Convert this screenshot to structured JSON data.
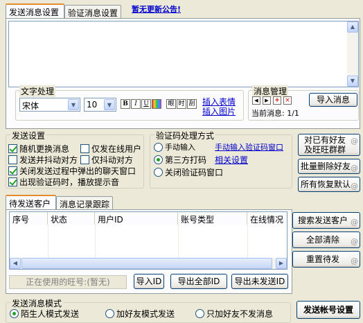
{
  "tabs": {
    "send_settings": "发送消息设置",
    "verify_settings": "验证消息设置",
    "announcement": "暂无更新公告!"
  },
  "text_processing": {
    "title": "文字处理",
    "font": "宋体",
    "size": "10",
    "bold": "B",
    "italic": "I",
    "underline": "U",
    "fx1": "眼",
    "fx2": "时",
    "fx3": "刮",
    "insert_emoji": "插入表情",
    "insert_image": "插入图片"
  },
  "msg_manage": {
    "title": "消息管理",
    "current_label": "当前消息:",
    "current_value": "1/1",
    "import_button": "导入消息"
  },
  "send_settings": {
    "title": "发送设置",
    "options": [
      {
        "label": "随机更换消息",
        "checked": true
      },
      {
        "label": "仅发在线用户",
        "checked": false
      },
      {
        "label": "发送并抖动对方",
        "checked": false
      },
      {
        "label": "仅抖动对方",
        "checked": false
      },
      {
        "label": "关闭发送过程中弹出的聊天窗口",
        "checked": true
      },
      {
        "label": "出现验证码时，播放提示音",
        "checked": true
      }
    ]
  },
  "captcha": {
    "title": "验证码处理方式",
    "manual": "手动输入",
    "manual_link": "手动输入验证码窗口",
    "third_party": "第三方打码",
    "third_party_link": "相关设置",
    "close": "关闭验证码窗口",
    "selected": "third_party"
  },
  "right_buttons": {
    "friends_group": "对已有好友及旺旺群群发",
    "batch_delete": "批量删除好友",
    "restore_default": "所有恢复默认"
  },
  "lower_tabs": {
    "pending": "待发送客户",
    "log": "消息记录跟踪"
  },
  "table": {
    "columns": [
      "序号",
      "状态",
      "用户ID",
      "账号类型",
      "在线情况"
    ]
  },
  "table_buttons": {
    "search": "搜索发送客户",
    "clear_all": "全部清除",
    "reset_pending": "重置待发"
  },
  "bottom": {
    "wangwang_placeholder": "正在使用的旺号:(暂无)",
    "import_id": "导入ID",
    "export_all": "导出全部ID",
    "export_unsent": "导出未发送ID"
  },
  "mode": {
    "title": "发送消息模式",
    "stranger": "陌生人模式发送",
    "add_friend": "加好友模式发送",
    "only_add": "只加好友不发消息",
    "selected": "stranger",
    "account_settings": "发送帐号设置"
  }
}
